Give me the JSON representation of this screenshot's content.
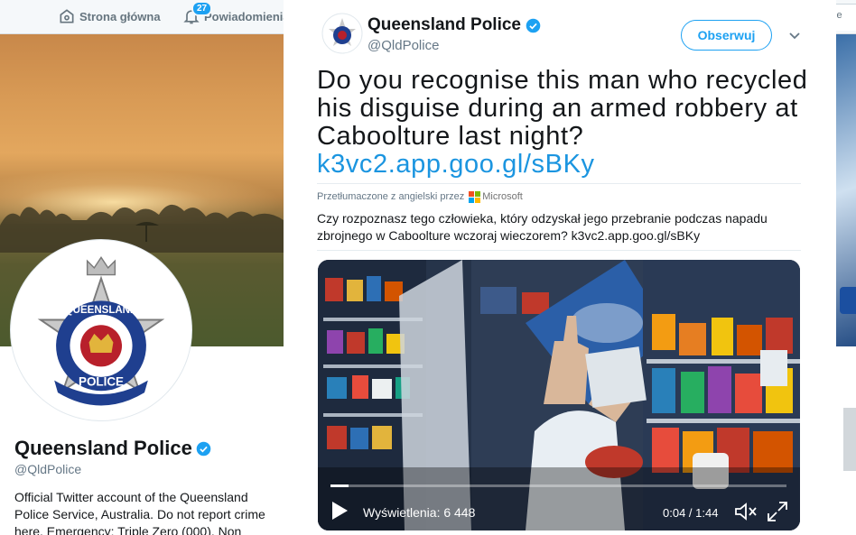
{
  "topnav": {
    "home_label": "Strona główna",
    "notifications_label": "Powiadomienia",
    "notifications_count": "27",
    "right_fragment": "ze"
  },
  "profile": {
    "name": "Queensland Police",
    "handle": "@QldPolice",
    "bio": "Official Twitter account of the Queensland Police Service, Australia. Do not report crime here. Emergency: Triple Zero (000). Non"
  },
  "tweet": {
    "author_name": "Queensland Police",
    "author_handle": "@QldPolice",
    "follow_label": "Obserwuj",
    "text": "Do you recognise this man who recycled his disguise during an armed robbery at Caboolture last night?",
    "link": "k3vc2.app.goo.gl/sBKy",
    "translated_by": "Przetłumaczone z angielski przez",
    "translator": "Microsoft",
    "translation": "Czy rozpoznasz tego człowieka, który odzyskał jego przebranie podczas napadu zbrojnego w Caboolture wczoraj wieczorem? k3vc2.app.goo.gl/sBKy"
  },
  "video": {
    "views": "Wyświetlenia: 6 448",
    "time": "0:04 / 1:44",
    "progress": 0.04
  },
  "colors": {
    "accent": "#1da1f2",
    "link": "#1b95e0",
    "verified": "#1da1f2"
  },
  "icons": [
    "home-icon",
    "bell-icon",
    "verified-icon",
    "chevron-down-icon",
    "play-icon",
    "mute-icon",
    "fullscreen-icon",
    "microsoft-logo"
  ]
}
